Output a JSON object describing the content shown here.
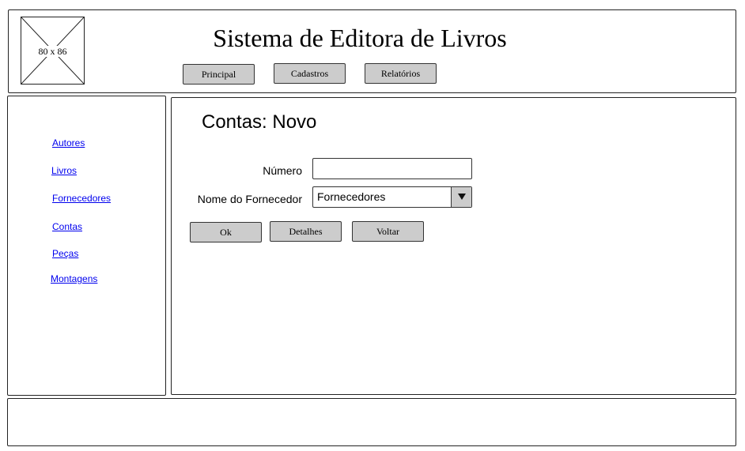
{
  "header": {
    "logo_placeholder": "80 x 86",
    "title": "Sistema de Editora de Livros",
    "nav": {
      "principal": "Principal",
      "cadastros": "Cadastros",
      "relatorios": "Relatórios"
    }
  },
  "sidebar": {
    "links": {
      "autores": "Autores",
      "livros": "Livros",
      "fornecedores": "Fornecedores",
      "contas": "Contas",
      "pecas": "Peças",
      "montagens": "Montagens"
    }
  },
  "main": {
    "page_title": "Contas: Novo",
    "form": {
      "numero_label": "Número",
      "numero_value": "",
      "fornecedor_label": "Nome do Fornecedor",
      "fornecedor_selected": "Fornecedores",
      "dropdown_icon": "triangle-down-icon"
    },
    "buttons": {
      "ok": "Ok",
      "detalhes": "Detalhes",
      "voltar": "Voltar"
    }
  },
  "colors": {
    "button_fill": "#cccccc",
    "link": "#0000ee",
    "border": "#222222"
  }
}
